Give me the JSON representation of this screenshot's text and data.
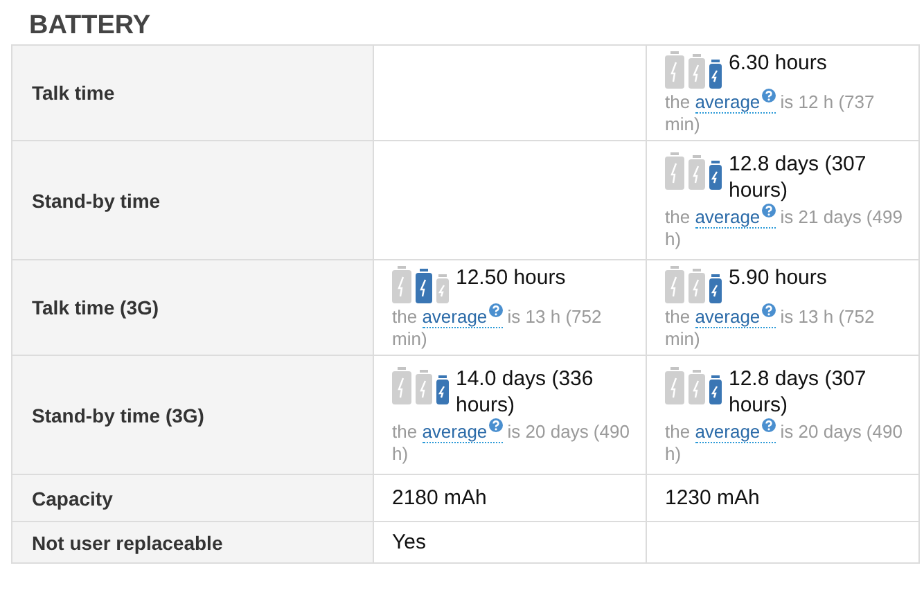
{
  "section_title": "BATTERY",
  "rows": [
    {
      "label": "Talk time",
      "cells": [
        {
          "kind": "empty"
        },
        {
          "kind": "rating",
          "value": "6.30 hours",
          "batteries": [
            {
              "selected": false
            },
            {
              "selected": false
            },
            {
              "selected": true
            }
          ],
          "note_before": "the",
          "link": "average",
          "note_after": "is 12 h (737 min)"
        }
      ]
    },
    {
      "label": "Stand-by time",
      "cells": [
        {
          "kind": "empty"
        },
        {
          "kind": "rating",
          "value": "12.8 days (307 hours)",
          "batteries": [
            {
              "selected": false
            },
            {
              "selected": false
            },
            {
              "selected": true
            }
          ],
          "note_before": "the",
          "link": "average",
          "note_after": "is 21 days (499 h)"
        }
      ]
    },
    {
      "label": "Talk time (3G)",
      "cells": [
        {
          "kind": "rating",
          "value": "12.50 hours",
          "batteries": [
            {
              "selected": false
            },
            {
              "selected": true
            },
            {
              "selected": false
            }
          ],
          "note_before": "the",
          "link": "average",
          "note_after": "is 13 h (752 min)"
        },
        {
          "kind": "rating",
          "value": "5.90 hours",
          "batteries": [
            {
              "selected": false
            },
            {
              "selected": false
            },
            {
              "selected": true
            }
          ],
          "note_before": "the",
          "link": "average",
          "note_after": "is 13 h (752 min)"
        }
      ]
    },
    {
      "label": "Stand-by time (3G)",
      "cells": [
        {
          "kind": "rating",
          "value": "14.0 days (336 hours)",
          "batteries": [
            {
              "selected": false
            },
            {
              "selected": false
            },
            {
              "selected": true
            }
          ],
          "note_before": "the",
          "link": "average",
          "note_after": "is 20 days (490 h)"
        },
        {
          "kind": "rating",
          "value": "12.8 days (307 hours)",
          "batteries": [
            {
              "selected": false
            },
            {
              "selected": false
            },
            {
              "selected": true
            }
          ],
          "note_before": "the",
          "link": "average",
          "note_after": "is 20 days (490 h)"
        }
      ]
    },
    {
      "label": "Capacity",
      "cells": [
        {
          "kind": "text",
          "value": "2180 mAh"
        },
        {
          "kind": "text",
          "value": "1230 mAh"
        }
      ]
    },
    {
      "label": "Not user replaceable",
      "cells": [
        {
          "kind": "text",
          "value": "Yes"
        },
        {
          "kind": "empty"
        }
      ]
    }
  ]
}
